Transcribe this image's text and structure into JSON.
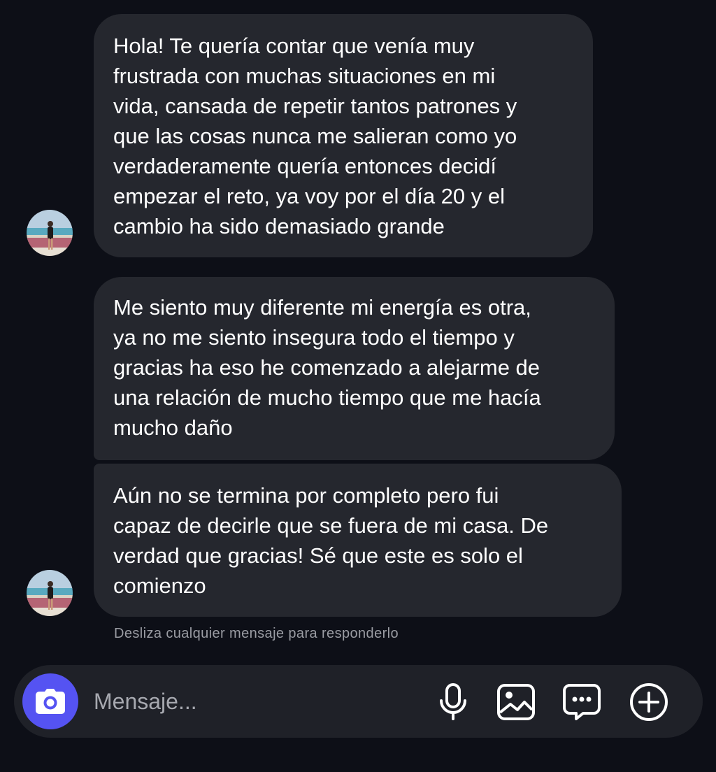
{
  "messages": [
    {
      "text": "Hola! Te quería contar que venía muy\nfrustrada con muchas situaciones en mi\nvida, cansada de repetir tantos patrones y\nque las cosas nunca me salieran como yo\nverdaderamente quería entonces decidí\nempezar el reto, ya voy por el día 20 y el\ncambio ha sido demasiado grande"
    },
    {
      "text": "Me siento muy diferente mi energía es otra,\nya no me siento insegura todo el tiempo y\ngracias ha eso he comenzado a alejarme de\nuna relación de mucho tiempo que me hacía\nmucho daño"
    },
    {
      "text": "Aún no se termina por completo pero fui\ncapaz de decirle que se fuera de mi casa. De\nverdad que gracias! Sé que este es solo el\ncomienzo"
    }
  ],
  "hint": "Desliza cualquier mensaje para responderlo",
  "composer": {
    "placeholder": "Mensaje...",
    "icons": [
      "camera-icon",
      "microphone-icon",
      "image-icon",
      "sticker-chat-icon",
      "plus-icon"
    ]
  },
  "colors": {
    "background": "#0d0f17",
    "bubble": "#25272e",
    "composer": "#1f2128",
    "camera_button": "#5553f2",
    "hint_text": "#9a9ca3"
  }
}
